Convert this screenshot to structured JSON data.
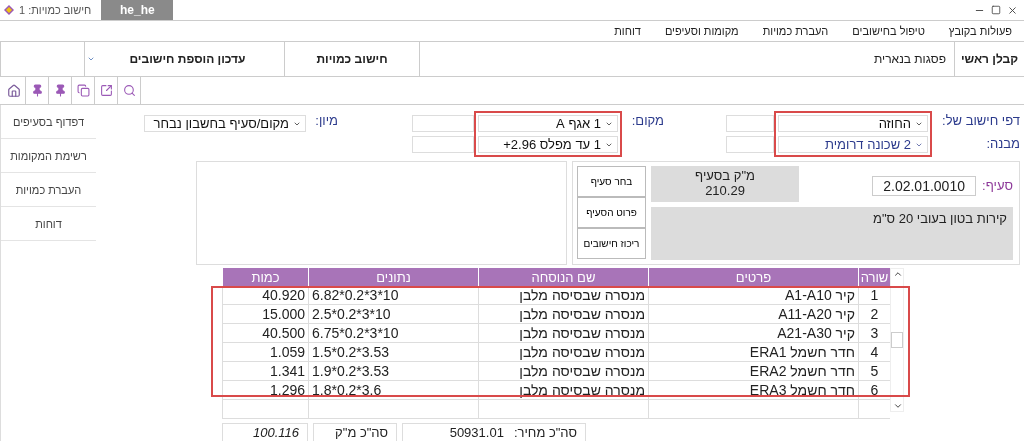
{
  "window": {
    "title": "1 :חישוב כמויות",
    "tab": "he_he"
  },
  "menu": [
    "פעולות בקובץ",
    "טיפול בחישובים",
    "העברת כמויות",
    "מקומות וסעיפים",
    "דוחות"
  ],
  "header": {
    "contractor": "קבלן ראשי",
    "project": "פסגות בנארית",
    "mode": "חישוב כמויות",
    "action": "עדכון הוספת חישובים"
  },
  "sidebar": {
    "items": [
      "דפדוף בסעיפים",
      "רשימת המקומות",
      "העברת כמויות",
      "דוחות"
    ]
  },
  "filters": {
    "sheet": {
      "labels": [
        "דפי חישוב של:",
        "מבנה:"
      ],
      "values": [
        "החוזה",
        "2 שכונה דרומית"
      ],
      "highlighted": true
    },
    "place": {
      "labels": [
        "מקום:"
      ],
      "values": [
        "1 אגף A",
        "1 עד מפלס 2.96+"
      ],
      "highlighted": true
    },
    "sort": {
      "label": "מיון:",
      "value": "מקום/סעיף בחשבון נבחר"
    }
  },
  "section": {
    "label": "סעיף:",
    "code": "2.02.01.0010",
    "volume_label": "מ\"ק  בסעיף",
    "volume": "210.29",
    "description": "קירות בטון בעובי 20 ס\"מ",
    "buttons": [
      "בחר סעיף",
      "פרוט הסעיף",
      "ריכוז חישובים"
    ]
  },
  "table": {
    "columns": [
      "שורה",
      "פרטים",
      "שם הנוסחה",
      "נתונים",
      "כמות"
    ],
    "highlighted": true,
    "rows": [
      {
        "cells": [
          "1",
          "קיר A1-A10",
          "מנסרה שבסיסה מלבן",
          "6.82*0.2*3*10",
          "40.920"
        ]
      },
      {
        "cells": [
          "2",
          "קיר A11-A20",
          "מנסרה שבסיסה מלבן",
          "2.5*0.2*3*10",
          "15.000"
        ]
      },
      {
        "cells": [
          "3",
          "קיר A21-A30",
          "מנסרה שבסיסה מלבן",
          "6.75*0.2*3*10",
          "40.500"
        ]
      },
      {
        "cells": [
          "4",
          "חדר חשמל ERA1",
          "מנסרה שבסיסה מלבן",
          "1.5*0.2*3.53",
          "1.059"
        ]
      },
      {
        "cells": [
          "5",
          "חדר חשמל ERA2",
          "מנסרה שבסיסה מלבן",
          "1.9*0.2*3.53",
          "1.341"
        ]
      },
      {
        "cells": [
          "6",
          "חדר חשמל ERA3",
          "מנסרה שבסיסה מלבן",
          "1.8*0.2*3.6",
          "1.296"
        ]
      }
    ]
  },
  "totals": {
    "price_label": "סה\"כ מחיר:",
    "price": "50931.01",
    "quantity_label": "סה\"כ  מ\"ק",
    "quantity": "100.116"
  }
}
